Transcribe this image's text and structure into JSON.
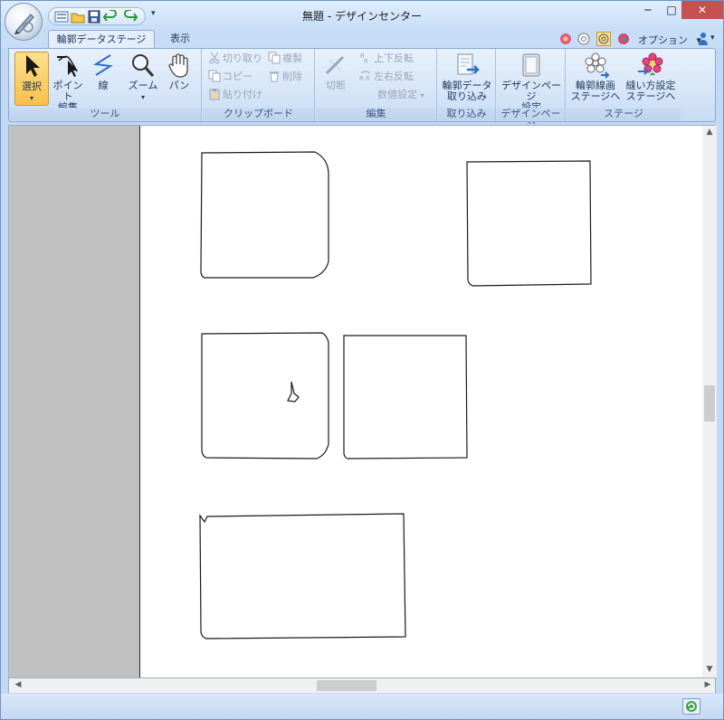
{
  "window": {
    "title": "無題 - デザインセンター",
    "minimize": "─",
    "maximize": "□",
    "close": "✕"
  },
  "quick_access": {
    "dropdown": "▾"
  },
  "tabs": [
    {
      "label": "輪郭データステージ"
    },
    {
      "label": "表示"
    }
  ],
  "options": {
    "label": "オプション",
    "arrow": "▾",
    "user_arrow": "▾"
  },
  "ribbon": {
    "groups": {
      "tools": {
        "label": "ツール",
        "select": "選択",
        "point_edit_1": "ポイント",
        "point_edit_2": "編集",
        "line": "線",
        "zoom": "ズーム",
        "pan": "パン"
      },
      "clipboard": {
        "label": "クリップボード",
        "cut": "切り取り",
        "copy": "コピー",
        "paste": "貼り付け",
        "duplicate": "複製",
        "delete": "削除"
      },
      "edit": {
        "label": "編集",
        "cut_line": "切断",
        "flip_vertical": "上下反転",
        "flip_horizontal": "左右反転",
        "numeric_settings": "数値設定"
      },
      "import": {
        "label": "取り込み",
        "import_outline_1": "輪郭データ",
        "import_outline_2": "取り込み"
      },
      "design_page": {
        "label": "デザインページ",
        "settings_1": "デザインページ",
        "settings_2": "設定"
      },
      "stage": {
        "label": "ステージ",
        "to_outline_1": "輪郭線画",
        "to_outline_2": "ステージへ",
        "to_sewing_1": "縫い方設定",
        "to_sewing_2": "ステージへ"
      }
    }
  },
  "scroll": {
    "up": "▲",
    "down": "▼",
    "left": "◀",
    "right": "▶"
  },
  "colors": {
    "accent": "#4a7bbf",
    "selected_tool": "#f7c04b",
    "close_button": "#c75050",
    "left_pane": "#c0c0c0"
  }
}
